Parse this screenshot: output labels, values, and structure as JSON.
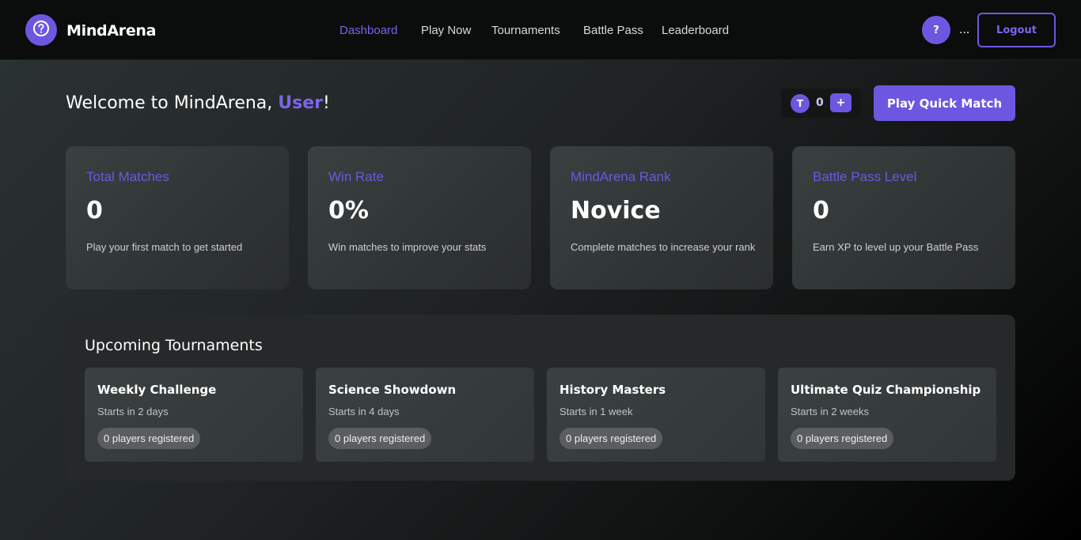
{
  "header": {
    "brand": "MindArena",
    "nav": [
      {
        "label": "Dashboard",
        "active": true
      },
      {
        "label": "Play Now",
        "active": false
      },
      {
        "label": "Tournaments",
        "active": false
      },
      {
        "label": "Battle Pass",
        "active": false
      },
      {
        "label": "Leaderboard",
        "active": false
      }
    ],
    "help_label": "?",
    "user_label": "...",
    "logout_label": "Logout"
  },
  "welcome": {
    "prefix": "Welcome to MindArena, ",
    "username": "User",
    "suffix": "!"
  },
  "tokens": {
    "icon_letter": "T",
    "count": "0",
    "add_label": "+"
  },
  "quick_match_label": "Play Quick Match",
  "stats": [
    {
      "label": "Total Matches",
      "value": "0",
      "description": "Play your first match to get started"
    },
    {
      "label": "Win Rate",
      "value": "0%",
      "description": "Win matches to improve your stats"
    },
    {
      "label": "MindArena Rank",
      "value": "Novice",
      "description": "Complete matches to increase your rank"
    },
    {
      "label": "Battle Pass Level",
      "value": "0",
      "description": "Earn XP to level up your Battle Pass"
    }
  ],
  "tournaments": {
    "title": "Upcoming Tournaments",
    "items": [
      {
        "name": "Weekly Challenge",
        "starts": "Starts in 2 days",
        "players": "0 players registered"
      },
      {
        "name": "Science Showdown",
        "starts": "Starts in 4 days",
        "players": "0 players registered"
      },
      {
        "name": "History Masters",
        "starts": "Starts in 1 week",
        "players": "0 players registered"
      },
      {
        "name": "Ultimate Quiz Championship",
        "starts": "Starts in 2 weeks",
        "players": "0 players registered"
      }
    ]
  },
  "colors": {
    "accent": "#6e57e0",
    "accent_text": "#7b65ec"
  }
}
